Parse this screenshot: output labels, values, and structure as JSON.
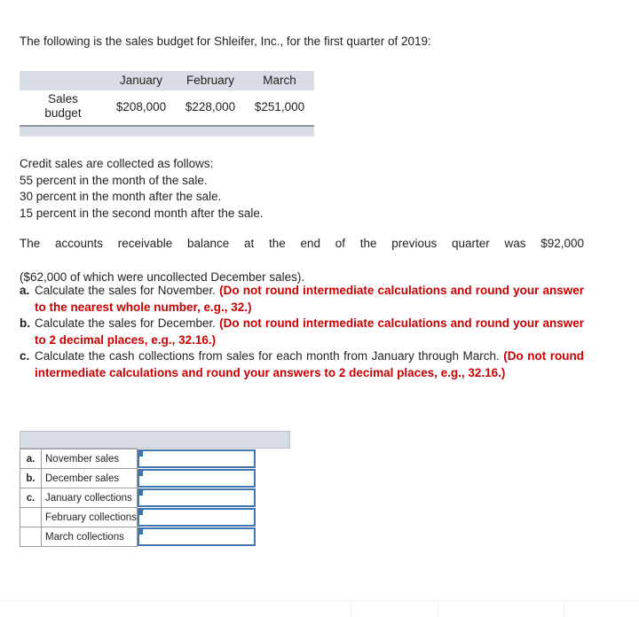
{
  "intro": {
    "text": "The following is the sales budget for Shleifer, Inc., for the first quarter of 2019:"
  },
  "budget_table": {
    "corner_label": "",
    "columns": [
      "January",
      "February",
      "March"
    ],
    "row_label": "Sales budget",
    "row_label_line1": "Sales",
    "row_label_line2": "budget",
    "values": [
      "$208,000",
      "$228,000",
      "$251,000"
    ]
  },
  "terms": {
    "heading": "Credit sales are collected as follows:",
    "lines": [
      "55 percent in the month of the sale.",
      "30 percent in the month after the sale.",
      "15 percent in the second month after the sale."
    ]
  },
  "ar_paragraph": {
    "line1": "The accounts receivable balance at the end of the previous quarter was $92,000",
    "line2": "($62,000 of which were uncollected December sales)."
  },
  "requirements": [
    {
      "marker": "a.",
      "black": "Calculate the sales for November. ",
      "red": "(Do not round intermediate calculations and round your answer to the nearest whole number, e.g., 32.)"
    },
    {
      "marker": "b.",
      "black": "Calculate the sales for December. ",
      "red": "(Do not round intermediate calculations and round your answer to 2 decimal places, e.g., 32.16.)"
    },
    {
      "marker": "c.",
      "black": "Calculate the cash collections from sales for each month from January through March. ",
      "red": "(Do not round intermediate calculations and round your answers to 2 decimal places, e.g., 32.16.)"
    }
  ],
  "answer_table": {
    "header_label": "",
    "rows": [
      {
        "letter": "a.",
        "label": "November sales",
        "value": "",
        "placeholder": ""
      },
      {
        "letter": "b.",
        "label": "December sales",
        "value": "",
        "placeholder": ""
      },
      {
        "letter": "c.",
        "label": "January collections",
        "value": "",
        "placeholder": ""
      },
      {
        "letter": "",
        "label": "February collections",
        "value": "",
        "placeholder": ""
      },
      {
        "letter": "",
        "label": "March collections",
        "value": "",
        "placeholder": ""
      }
    ]
  },
  "colors": {
    "red_instruction": "#cc0000",
    "table_header_bg": "#d7dce5",
    "input_border": "#4477b0",
    "text": "#231f20"
  }
}
